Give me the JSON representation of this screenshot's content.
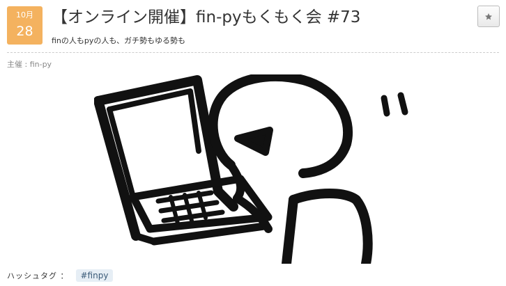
{
  "event": {
    "month": "10月",
    "day": "28",
    "title": "【オンライン開催】fin-pyもくもく会 #73",
    "catch": "finの人もpyの人も、ガチ勢もゆる勢も",
    "owner": "主催 : fin-py"
  },
  "hashtag": {
    "label": "ハッシュタグ ：",
    "tag": "#finpy"
  },
  "icons": {
    "bookmark": "star-icon",
    "image": "person-at-laptop-illustration"
  }
}
